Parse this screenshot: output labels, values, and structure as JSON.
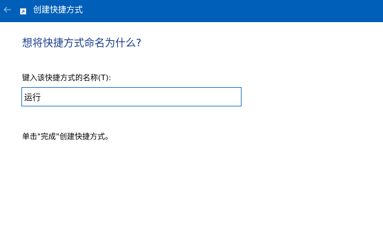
{
  "window": {
    "title": "创建快捷方式",
    "back_icon": "back-arrow-icon",
    "app_icon": "shortcut-icon",
    "titlebar_color": "#005fb8"
  },
  "page": {
    "heading": "想将快捷方式命名为什么?",
    "heading_color": "#1a3d8f",
    "field_label": "键入该快捷方式的名称(T):",
    "name_value": "运行",
    "hint": "单击\"完成\"创建快捷方式。"
  }
}
